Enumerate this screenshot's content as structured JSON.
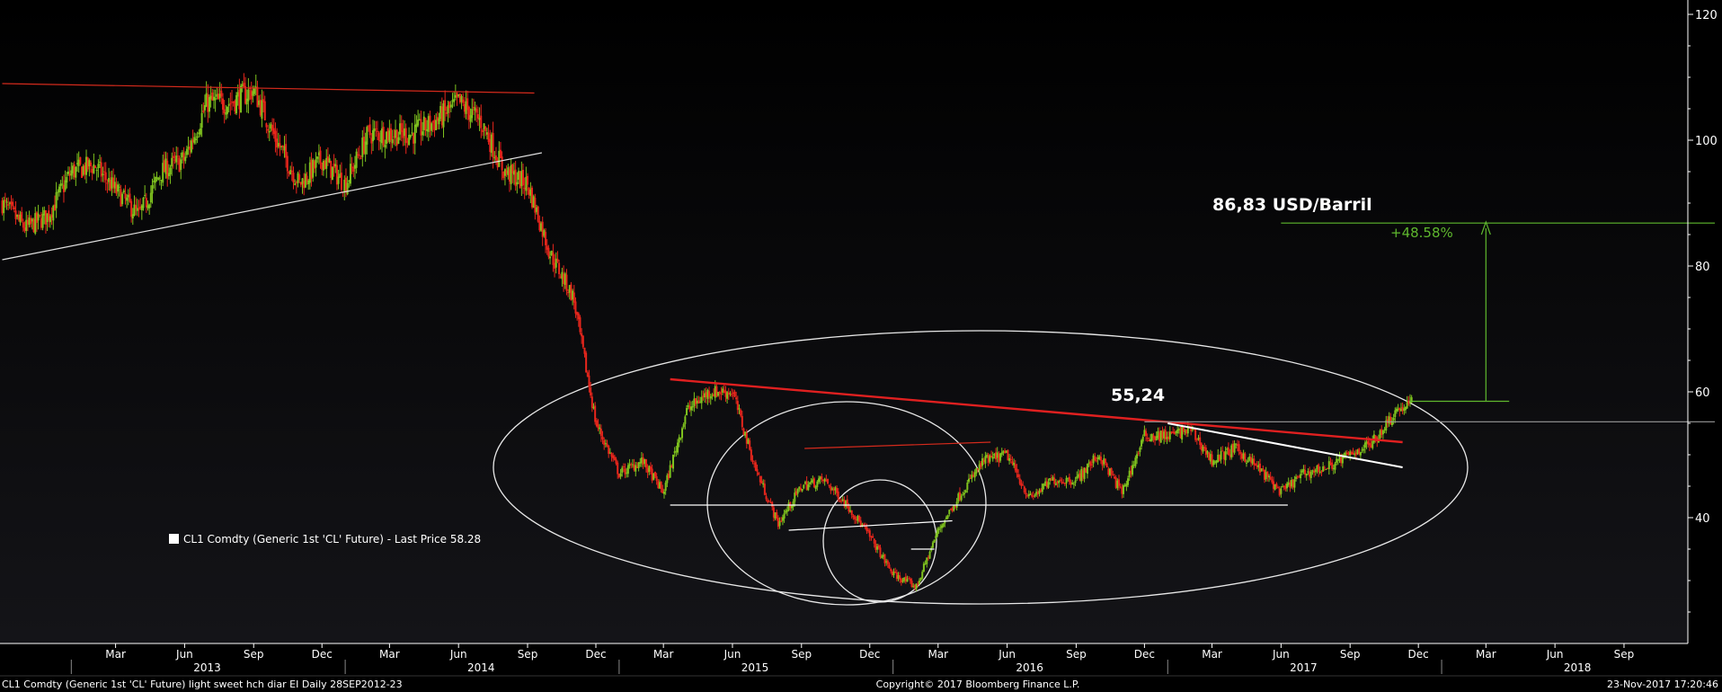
{
  "chart_data": {
    "type": "candlestick",
    "title": "",
    "legend": "CL1 Comdty (Generic 1st 'CL' Future) - Last Price 58.28",
    "footer_left": "CL1 Comdty (Generic 1st 'CL' Future) light sweet hch diar EI  Daily 28SEP2012-23",
    "footer_center": "Copyright© 2017 Bloomberg Finance L.P.",
    "footer_right": "23-Nov-2017 17:20:46",
    "ylim": [
      20,
      125
    ],
    "y_ticks": [
      "40",
      "60",
      "80",
      "100",
      "120"
    ],
    "x_months": [
      "Mar",
      "Jun",
      "Sep",
      "Dec",
      "Mar",
      "Jun",
      "Sep",
      "Dec",
      "Mar",
      "Jun",
      "Sep",
      "Dec",
      "Mar",
      "Jun",
      "Sep",
      "Dec",
      "Mar",
      "Jun",
      "Sep",
      "Dec",
      "Mar",
      "Jun",
      "Sep"
    ],
    "x_years": [
      "2013",
      "2014",
      "2015",
      "2016",
      "2017",
      "2018"
    ],
    "annotations": {
      "target_label": "86,83 USD/Barril",
      "target_pct": "+48.58%",
      "neckline_label": "55,24",
      "target_value": 86.83,
      "neckline_value": 55.24
    },
    "price_path": [
      {
        "date": "2012-10-01",
        "price": 90
      },
      {
        "date": "2012-11-01",
        "price": 86
      },
      {
        "date": "2012-12-01",
        "price": 88
      },
      {
        "date": "2013-01-01",
        "price": 95
      },
      {
        "date": "2013-02-01",
        "price": 96
      },
      {
        "date": "2013-03-01",
        "price": 92
      },
      {
        "date": "2013-04-01",
        "price": 88
      },
      {
        "date": "2013-05-01",
        "price": 95
      },
      {
        "date": "2013-06-01",
        "price": 97
      },
      {
        "date": "2013-07-01",
        "price": 106
      },
      {
        "date": "2013-08-01",
        "price": 106
      },
      {
        "date": "2013-09-01",
        "price": 108
      },
      {
        "date": "2013-10-01",
        "price": 100
      },
      {
        "date": "2013-11-01",
        "price": 93
      },
      {
        "date": "2013-12-01",
        "price": 97
      },
      {
        "date": "2014-01-01",
        "price": 93
      },
      {
        "date": "2014-02-01",
        "price": 101
      },
      {
        "date": "2014-03-01",
        "price": 101
      },
      {
        "date": "2014-04-01",
        "price": 101
      },
      {
        "date": "2014-05-01",
        "price": 103
      },
      {
        "date": "2014-06-01",
        "price": 106
      },
      {
        "date": "2014-07-01",
        "price": 103
      },
      {
        "date": "2014-08-01",
        "price": 95
      },
      {
        "date": "2014-09-01",
        "price": 93
      },
      {
        "date": "2014-10-01",
        "price": 82
      },
      {
        "date": "2014-11-01",
        "price": 75
      },
      {
        "date": "2014-12-01",
        "price": 55
      },
      {
        "date": "2015-01-01",
        "price": 47
      },
      {
        "date": "2015-02-01",
        "price": 49
      },
      {
        "date": "2015-03-01",
        "price": 44
      },
      {
        "date": "2015-04-01",
        "price": 57
      },
      {
        "date": "2015-05-01",
        "price": 60
      },
      {
        "date": "2015-06-01",
        "price": 60
      },
      {
        "date": "2015-07-01",
        "price": 48
      },
      {
        "date": "2015-08-01",
        "price": 39
      },
      {
        "date": "2015-09-01",
        "price": 45
      },
      {
        "date": "2015-10-01",
        "price": 46
      },
      {
        "date": "2015-11-01",
        "price": 42
      },
      {
        "date": "2015-12-01",
        "price": 37
      },
      {
        "date": "2016-01-01",
        "price": 31
      },
      {
        "date": "2016-02-01",
        "price": 29
      },
      {
        "date": "2016-03-01",
        "price": 38
      },
      {
        "date": "2016-04-01",
        "price": 44
      },
      {
        "date": "2016-05-01",
        "price": 49
      },
      {
        "date": "2016-06-01",
        "price": 50
      },
      {
        "date": "2016-07-01",
        "price": 43
      },
      {
        "date": "2016-08-01",
        "price": 46
      },
      {
        "date": "2016-09-01",
        "price": 46
      },
      {
        "date": "2016-10-01",
        "price": 50
      },
      {
        "date": "2016-11-01",
        "price": 44
      },
      {
        "date": "2016-12-01",
        "price": 53
      },
      {
        "date": "2017-01-01",
        "price": 53
      },
      {
        "date": "2017-02-01",
        "price": 54
      },
      {
        "date": "2017-03-01",
        "price": 49
      },
      {
        "date": "2017-04-01",
        "price": 51
      },
      {
        "date": "2017-05-01",
        "price": 48
      },
      {
        "date": "2017-06-01",
        "price": 44
      },
      {
        "date": "2017-07-01",
        "price": 47
      },
      {
        "date": "2017-08-01",
        "price": 48
      },
      {
        "date": "2017-09-01",
        "price": 50
      },
      {
        "date": "2017-10-01",
        "price": 52
      },
      {
        "date": "2017-11-01",
        "price": 57
      },
      {
        "date": "2017-11-23",
        "price": 58.28
      }
    ],
    "drawings": [
      {
        "name": "top-resistance-line",
        "color": "#d42a1c",
        "from": [
          "2012-10-01",
          109
        ],
        "to": [
          "2014-09-10",
          107.5
        ]
      },
      {
        "name": "top-support-line",
        "color": "#e0e0e0",
        "from": [
          "2012-10-01",
          81
        ],
        "to": [
          "2014-09-20",
          98
        ]
      },
      {
        "name": "neckline-red",
        "color": "#e02020",
        "from": [
          "2015-03-10",
          62
        ],
        "to": [
          "2017-11-10",
          52
        ]
      },
      {
        "name": "base-support-line",
        "color": "#ffffff",
        "from": [
          "2015-03-10",
          42
        ],
        "to": [
          "2017-06-10",
          42
        ]
      },
      {
        "name": "mid-base-line",
        "color": "#ffffff",
        "from": [
          "2015-08-15",
          38
        ],
        "to": [
          "2016-03-20",
          39.5
        ]
      },
      {
        "name": "mid-top-line",
        "color": "#d42a1c",
        "from": [
          "2015-09-05",
          51
        ],
        "to": [
          "2016-05-10",
          52
        ]
      },
      {
        "name": "small-flag-line",
        "color": "#ffffff",
        "from": [
          "2016-01-25",
          35
        ],
        "to": [
          "2016-02-25",
          35
        ]
      },
      {
        "name": "right-top-line",
        "color": "#ffffff",
        "from": [
          "2017-01-01",
          55
        ],
        "to": [
          "2017-11-10",
          48
        ]
      },
      {
        "name": "gray-horizontal",
        "color": "#9a9a9a",
        "from": [
          "2016-12-01",
          55.24
        ],
        "to": [
          "2018-12-31",
          55.24
        ]
      },
      {
        "name": "target-line",
        "color": "#5fb82e",
        "from": [
          "2017-06-01",
          86.83
        ],
        "to": [
          "2018-12-31",
          86.83
        ]
      },
      {
        "name": "breakout-line",
        "color": "#5fb82e",
        "from": [
          "2017-11-20",
          58.5
        ],
        "to": [
          "2018-04-01",
          58.5
        ]
      }
    ],
    "colors": {
      "up": "#7fc21e",
      "down": "#e8261c",
      "background": "#000000",
      "axis": "#ffffff",
      "accent": "#5fb82e"
    }
  }
}
